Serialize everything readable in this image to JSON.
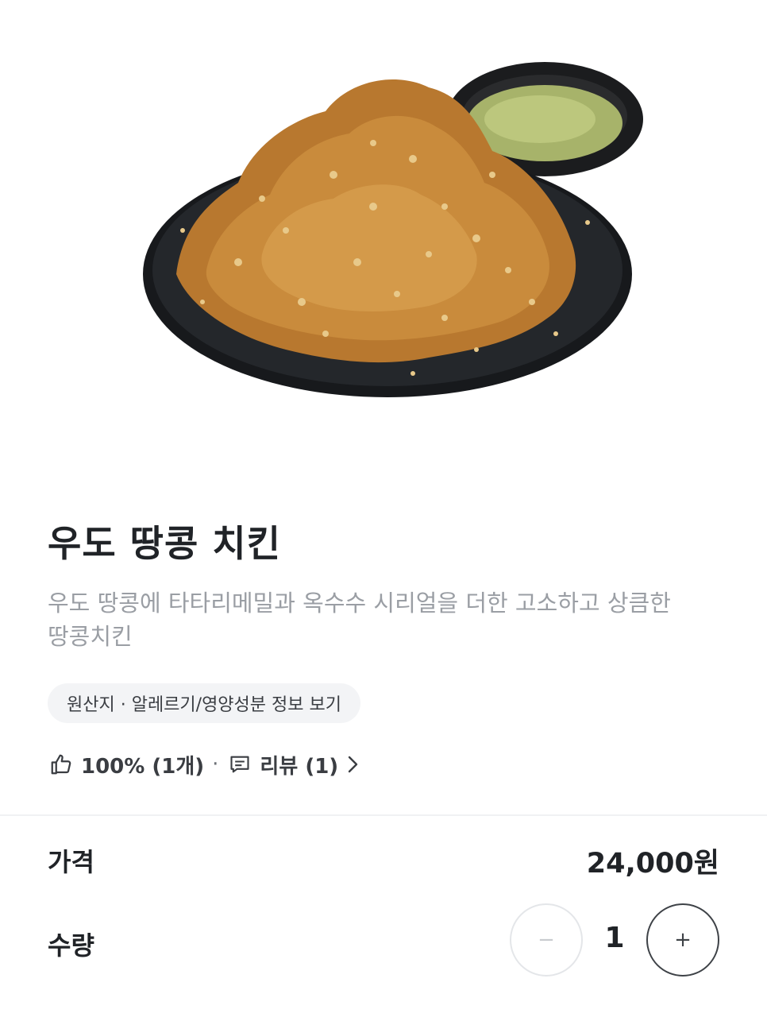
{
  "product": {
    "image_alt": "fried chicken on black plate with dipping sauce",
    "name": "우도 땅콩 치킨",
    "description": "우도 땅콩에 타타리메밀과 옥수수 시리얼을 더한 고소하고 상큼한 땅콩치킨"
  },
  "info_chip": {
    "label": "원산지 · 알레르기/영양성분 정보 보기"
  },
  "stats": {
    "like_icon": "thumbs-up-icon",
    "like_text": "100% (1개)",
    "separator": "·",
    "review_icon": "comment-icon",
    "review_text": "리뷰 (1)",
    "chevron_icon": "chevron-right-icon"
  },
  "order": {
    "price_label": "가격",
    "price_value": "24,000원",
    "quantity_label": "수량",
    "quantity_value": "1",
    "minus_label": "−",
    "plus_label": "+"
  }
}
